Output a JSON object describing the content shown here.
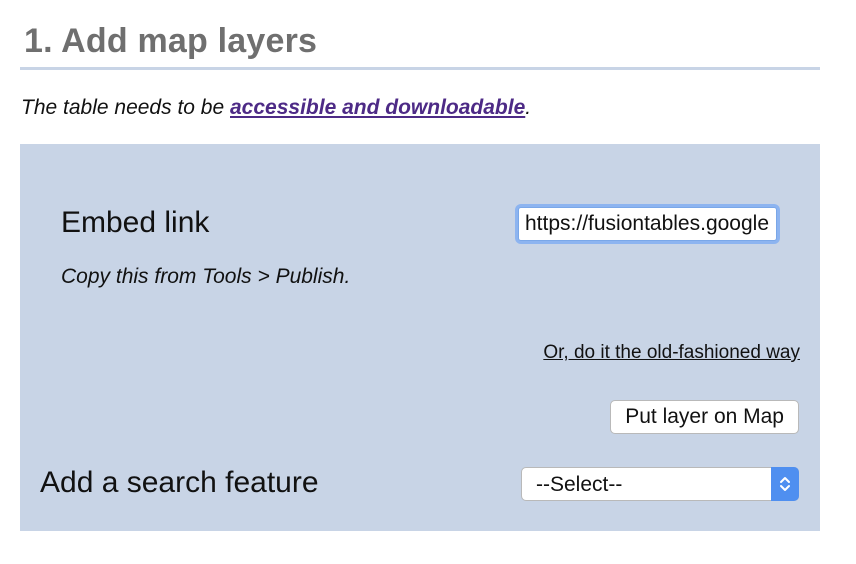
{
  "header": {
    "title": "1. Add map layers"
  },
  "note": {
    "prefix": "The table needs to be ",
    "link_text": "accessible and downloadable",
    "suffix": "."
  },
  "panel": {
    "embed_label": "Embed link",
    "embed_hint": "Copy this from Tools > Publish.",
    "embed_input_value": "https://fusiontables.google.com/",
    "old_fashioned_link": "Or, do it the old-fashioned way",
    "put_button_label": "Put layer on Map",
    "search_label": "Add a search feature",
    "select_value": "--Select--",
    "select_icon": "updown-chevron-icon"
  },
  "colors": {
    "panel_bg": "#c8d4e6",
    "title_color": "#6f6f6f",
    "link_color": "#4d2a86",
    "focus_ring": "#8db4f0",
    "select_arrow_bg": "#4f8ff0"
  }
}
